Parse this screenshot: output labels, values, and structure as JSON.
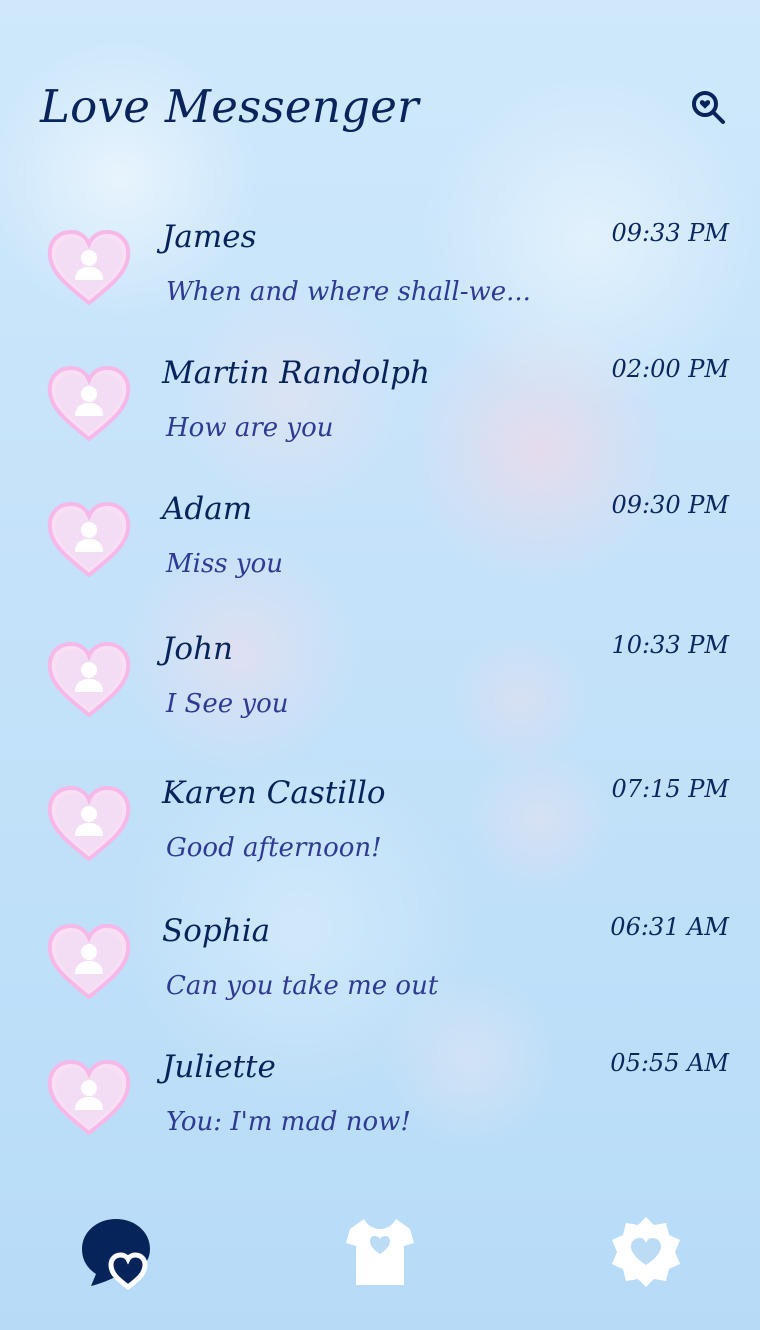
{
  "app": {
    "title": "Love Messenger"
  },
  "colors": {
    "primary_text": "#07245a",
    "preview_text": "#2f3b92",
    "heart_fill": "#f8dff3",
    "heart_outline": "#f6b8e8",
    "avatar_symbol": "#ffffff"
  },
  "header": {
    "search_icon": "search-heart-icon"
  },
  "conversations": [
    {
      "name": "James",
      "preview": "When and where shall-we...",
      "time": "09:33 PM",
      "avatar_icon": "heart-avatar-icon"
    },
    {
      "name": "Martin Randolph",
      "preview": "How are you",
      "time": "02:00 PM",
      "avatar_icon": "heart-avatar-icon"
    },
    {
      "name": "Adam",
      "preview": "Miss you",
      "time": "09:30 PM",
      "avatar_icon": "heart-avatar-icon"
    },
    {
      "name": "John",
      "preview": "I See you",
      "time": "10:33 PM",
      "avatar_icon": "heart-avatar-icon"
    },
    {
      "name": "Karen Castillo",
      "preview": "Good afternoon!",
      "time": "07:15 PM",
      "avatar_icon": "heart-avatar-icon"
    },
    {
      "name": "Sophia",
      "preview": "Can you take me out",
      "time": "06:31 AM",
      "avatar_icon": "heart-avatar-icon"
    },
    {
      "name": "Juliette",
      "preview": "You: I'm mad now!",
      "time": "05:55 AM",
      "avatar_icon": "heart-avatar-icon"
    }
  ],
  "bottom_nav": {
    "items": [
      {
        "icon": "chat-heart-icon",
        "active": true
      },
      {
        "icon": "shirt-heart-icon",
        "active": false
      },
      {
        "icon": "settings-heart-icon",
        "active": false
      }
    ]
  }
}
